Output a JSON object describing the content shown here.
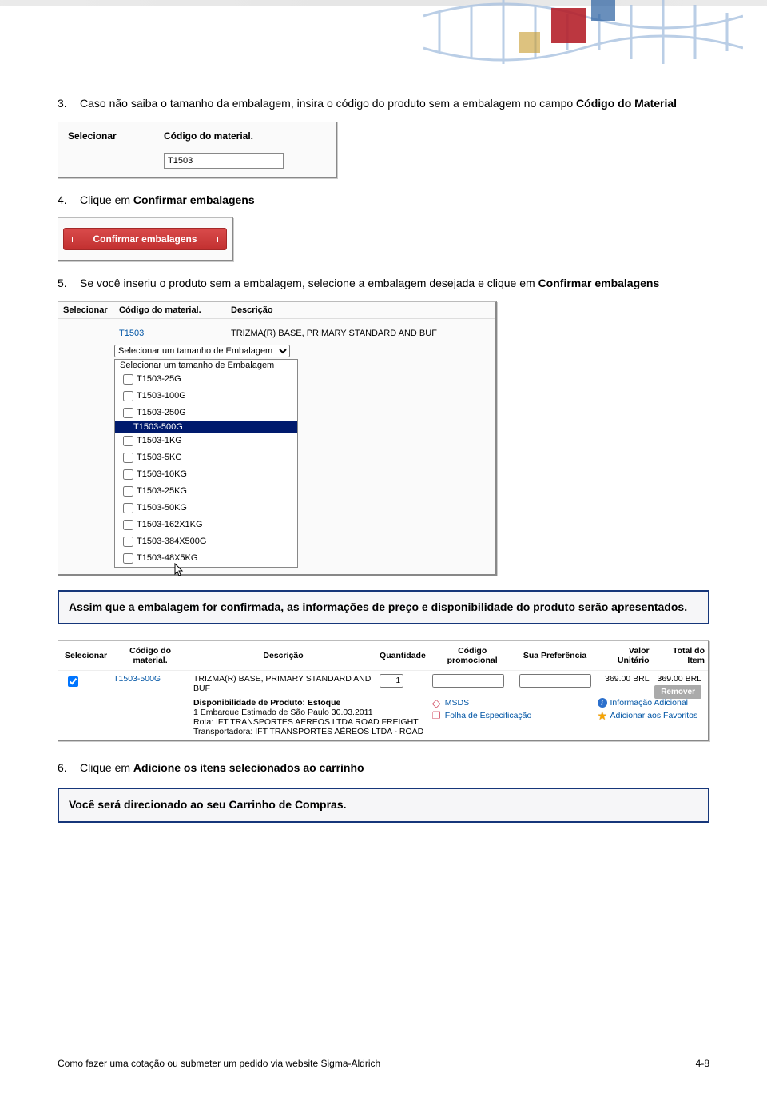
{
  "steps": {
    "s3": {
      "num": "3.",
      "text_a": "Caso não saiba o tamanho da embalagem, insira o código do produto sem a embalagem no campo ",
      "text_b": "Código do Material"
    },
    "s4": {
      "num": "4.",
      "text_a": "Clique em ",
      "text_b": "Confirmar embalagens"
    },
    "s5": {
      "num": "5.",
      "text_a": "Se você inseriu o produto sem a embalagem, selecione a embalagem desejada e clique em ",
      "text_b": "Confirmar embalagens"
    },
    "s6": {
      "num": "6.",
      "text_a": "Clique em ",
      "text_b": "Adicione os itens selecionados ao carrinho"
    }
  },
  "shot1": {
    "col_selecionar": "Selecionar",
    "col_codigo": "Código do material.",
    "input_value": "T1503"
  },
  "shot2": {
    "button": "Confirmar embalagens"
  },
  "shot3": {
    "col_selecionar": "Selecionar",
    "col_codigo": "Código do material.",
    "col_descricao": "Descrição",
    "prod_code": "T1503",
    "prod_desc": "TRIZMA(R) BASE, PRIMARY STANDARD AND BUF",
    "select_label": "Selecionar um tamanho de Embalagem",
    "options": [
      "Selecionar um tamanho de Embalagem",
      "T1503-25G",
      "T1503-100G",
      "T1503-250G",
      "T1503-500G",
      "T1503-1KG",
      "T1503-5KG",
      "T1503-10KG",
      "T1503-25KG",
      "T1503-50KG",
      "T1503-162X1KG",
      "T1503-384X500G",
      "T1503-48X5KG"
    ],
    "selected_index": 4
  },
  "callout1": "Assim que a embalagem for confirmada, as informações de preço e disponibilidade do produto serão apresentados.",
  "shot4": {
    "headers": [
      "Selecionar",
      "Código do material.",
      "Descrição",
      "Quantidade",
      "Código promocional",
      "Sua Preferência",
      "Valor Unitário",
      "Total do Item"
    ],
    "row": {
      "code": "T1503-500G",
      "desc": "TRIZMA(R) BASE, PRIMARY STANDARD AND BUF",
      "qty": "1",
      "promo": "",
      "pref": "",
      "unit": "369.00 BRL",
      "total": "369.00 BRL"
    },
    "avail_label": "Disponibilidade de Produto: Estoque",
    "avail_line1": "1 Embarque Estimado de São Paulo 30.03.2011",
    "avail_line2": "Rota: IFT TRANSPORTES AEREOS LTDA ROAD FREIGHT",
    "avail_line3": "Transportadora: IFT TRANSPORTES AÉREOS LTDA - ROAD",
    "link_msds": "MSDS",
    "link_folha": "Folha de Especificação",
    "link_info": "Informação Adicional",
    "link_fav": "Adicionar aos Favoritos",
    "btn_remover": "Remover"
  },
  "callout2": "Você será direcionado ao seu Carrinho de Compras.",
  "footer_left": "Como fazer uma cotação ou submeter um pedido via website Sigma-Aldrich",
  "footer_right": "4-8"
}
